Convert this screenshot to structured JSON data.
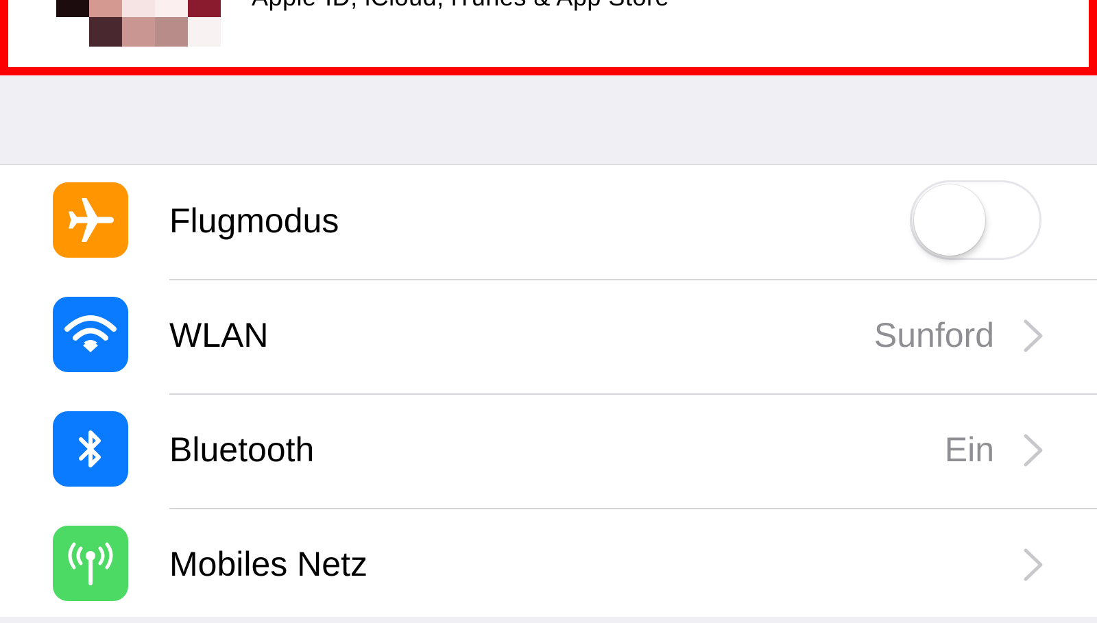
{
  "colors": {
    "highlight_border": "#fe0000",
    "airplane_tile": "#ff9500",
    "wlan_tile": "#0a7aff",
    "bluetooth_tile": "#0a7aff",
    "cellular_tile": "#4cd964",
    "detail_text": "#8e8e93",
    "background": "#efeff4"
  },
  "apple_id": {
    "subtitle": "Apple-ID, iCloud, iTunes & App Store",
    "avatar_icon": "pixelated-avatar"
  },
  "rows": [
    {
      "label": "Flugmodus",
      "icon": "airplane-icon",
      "toggle": {
        "on": false
      }
    },
    {
      "label": "WLAN",
      "icon": "wifi-icon",
      "detail": "Sunford",
      "chevron": true
    },
    {
      "label": "Bluetooth",
      "icon": "bluetooth-icon",
      "detail": "Ein",
      "chevron": true
    },
    {
      "label": "Mobiles Netz",
      "icon": "cellular-antenna-icon",
      "detail": "",
      "chevron": true
    }
  ]
}
